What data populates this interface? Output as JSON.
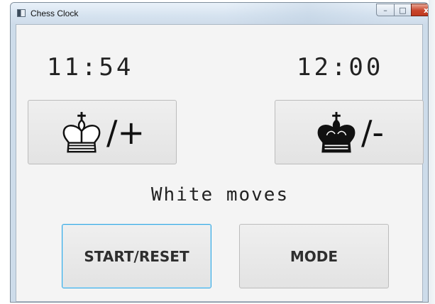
{
  "window": {
    "title": "Chess Clock",
    "controls": {
      "minimize": "–",
      "maximize": "□",
      "close": "x"
    }
  },
  "clock": {
    "white_time": "11:54",
    "black_time": "12:00",
    "white_button": {
      "icon": "white-king-icon",
      "symbol": "/+"
    },
    "black_button": {
      "icon": "black-king-icon",
      "symbol": "/-"
    },
    "status": "White moves"
  },
  "buttons": {
    "start_reset": "START/RESET",
    "mode": "MODE"
  },
  "colors": {
    "focus_border": "#36a7e0",
    "client_bg": "#f4f4f4"
  }
}
